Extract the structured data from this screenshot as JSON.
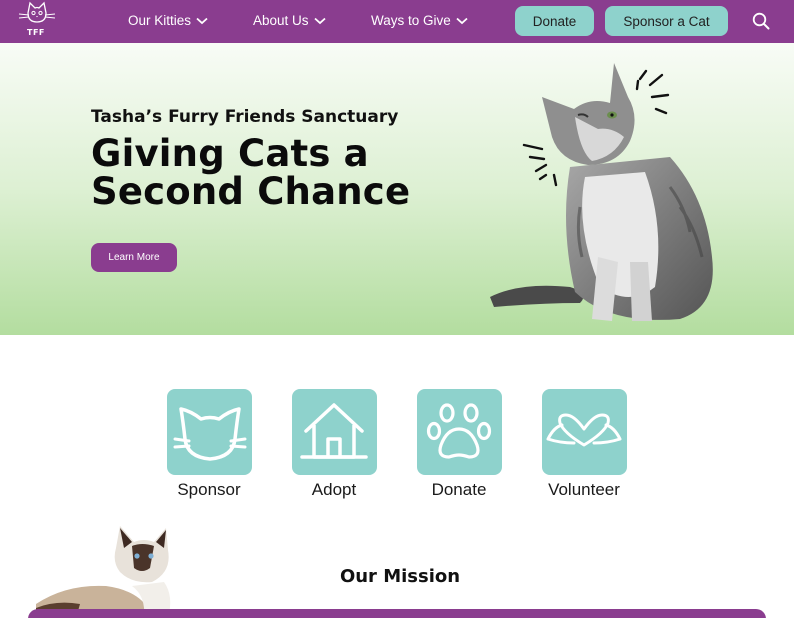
{
  "brand": {
    "logo_text": "TFF",
    "logo_icon": "cat-face-outline",
    "nav_color": "#8a3d8f",
    "accent": "#8ed2cc"
  },
  "nav": {
    "items": [
      {
        "label": "Our Kitties",
        "icon": "chevron-down-icon"
      },
      {
        "label": "About Us",
        "icon": "chevron-down-icon"
      },
      {
        "label": "Ways to Give",
        "icon": "chevron-down-icon"
      }
    ],
    "donate_label": "Donate",
    "sponsor_label": "Sponsor a Cat",
    "search_icon": "search-icon"
  },
  "hero": {
    "subtitle": "Tasha’s Furry Friends Sanctuary",
    "title": "Giving Cats a Second Chance",
    "button_label": "Learn More",
    "image": "fluffy-gray-cat-photo"
  },
  "tiles": [
    {
      "label": "Sponsor",
      "icon": "cat-face-icon"
    },
    {
      "label": "Adopt",
      "icon": "house-icon"
    },
    {
      "label": "Donate",
      "icon": "paw-icon"
    },
    {
      "label": "Volunteer",
      "icon": "heart-hands-icon"
    }
  ],
  "mission": {
    "title": "Our Mission",
    "image": "siamese-cat-photo"
  }
}
